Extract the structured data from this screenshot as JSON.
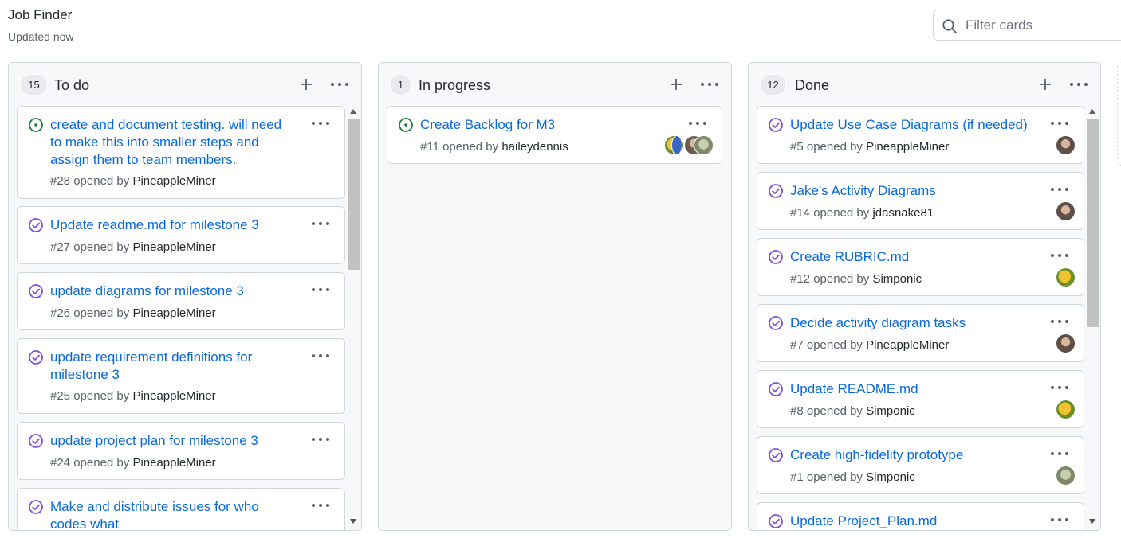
{
  "project": {
    "title": "Job Finder",
    "updated": "Updated now"
  },
  "filter": {
    "placeholder": "Filter cards",
    "icon": "search-icon"
  },
  "colors": {
    "link": "#0969da",
    "open_green": "#1a7f37",
    "closed_purple": "#8250df",
    "muted": "#57606a"
  },
  "columns": [
    {
      "name": "To do",
      "count": "15",
      "cards": [
        {
          "title": "create and document testing. will need to make this into smaller steps and assign them to team members.",
          "meta": "#28 opened by",
          "author": "PineappleMiner",
          "state": "open"
        },
        {
          "title": "Update readme.md for milestone 3",
          "meta": "#27 opened by",
          "author": "PineappleMiner",
          "state": "closed"
        },
        {
          "title": "update diagrams for milestone 3",
          "meta": "#26 opened by",
          "author": "PineappleMiner",
          "state": "closed"
        },
        {
          "title": "update requirement definitions for milestone 3",
          "meta": "#25 opened by",
          "author": "PineappleMiner",
          "state": "closed"
        },
        {
          "title": "update project plan for milestone 3",
          "meta": "#24 opened by",
          "author": "PineappleMiner",
          "state": "closed"
        },
        {
          "title": "Make and distribute issues for who codes what",
          "meta": "",
          "author": "",
          "state": "closed"
        }
      ]
    },
    {
      "name": "In progress",
      "count": "1",
      "cards": [
        {
          "title": "Create Backlog for M3",
          "meta": "#11 opened by",
          "author": "haileydennis",
          "state": "open"
        }
      ]
    },
    {
      "name": "Done",
      "count": "12",
      "cards": [
        {
          "title": "Update Use Case Diagrams (if needed)",
          "meta": "#5 opened by",
          "author": "PineappleMiner",
          "state": "closed"
        },
        {
          "title": "Jake's Activity Diagrams",
          "meta": "#14 opened by",
          "author": "jdasnake81",
          "state": "closed"
        },
        {
          "title": "Create RUBRIC.md",
          "meta": "#12 opened by",
          "author": "Simponic",
          "state": "closed"
        },
        {
          "title": "Decide activity diagram tasks",
          "meta": "#7 opened by",
          "author": "PineappleMiner",
          "state": "closed"
        },
        {
          "title": "Update README.md",
          "meta": "#8 opened by",
          "author": "Simponic",
          "state": "closed"
        },
        {
          "title": "Create high-fidelity prototype",
          "meta": "#1 opened by",
          "author": "Simponic",
          "state": "closed"
        },
        {
          "title": "Update Project_Plan.md",
          "meta": "",
          "author": "",
          "state": "closed"
        }
      ]
    }
  ]
}
